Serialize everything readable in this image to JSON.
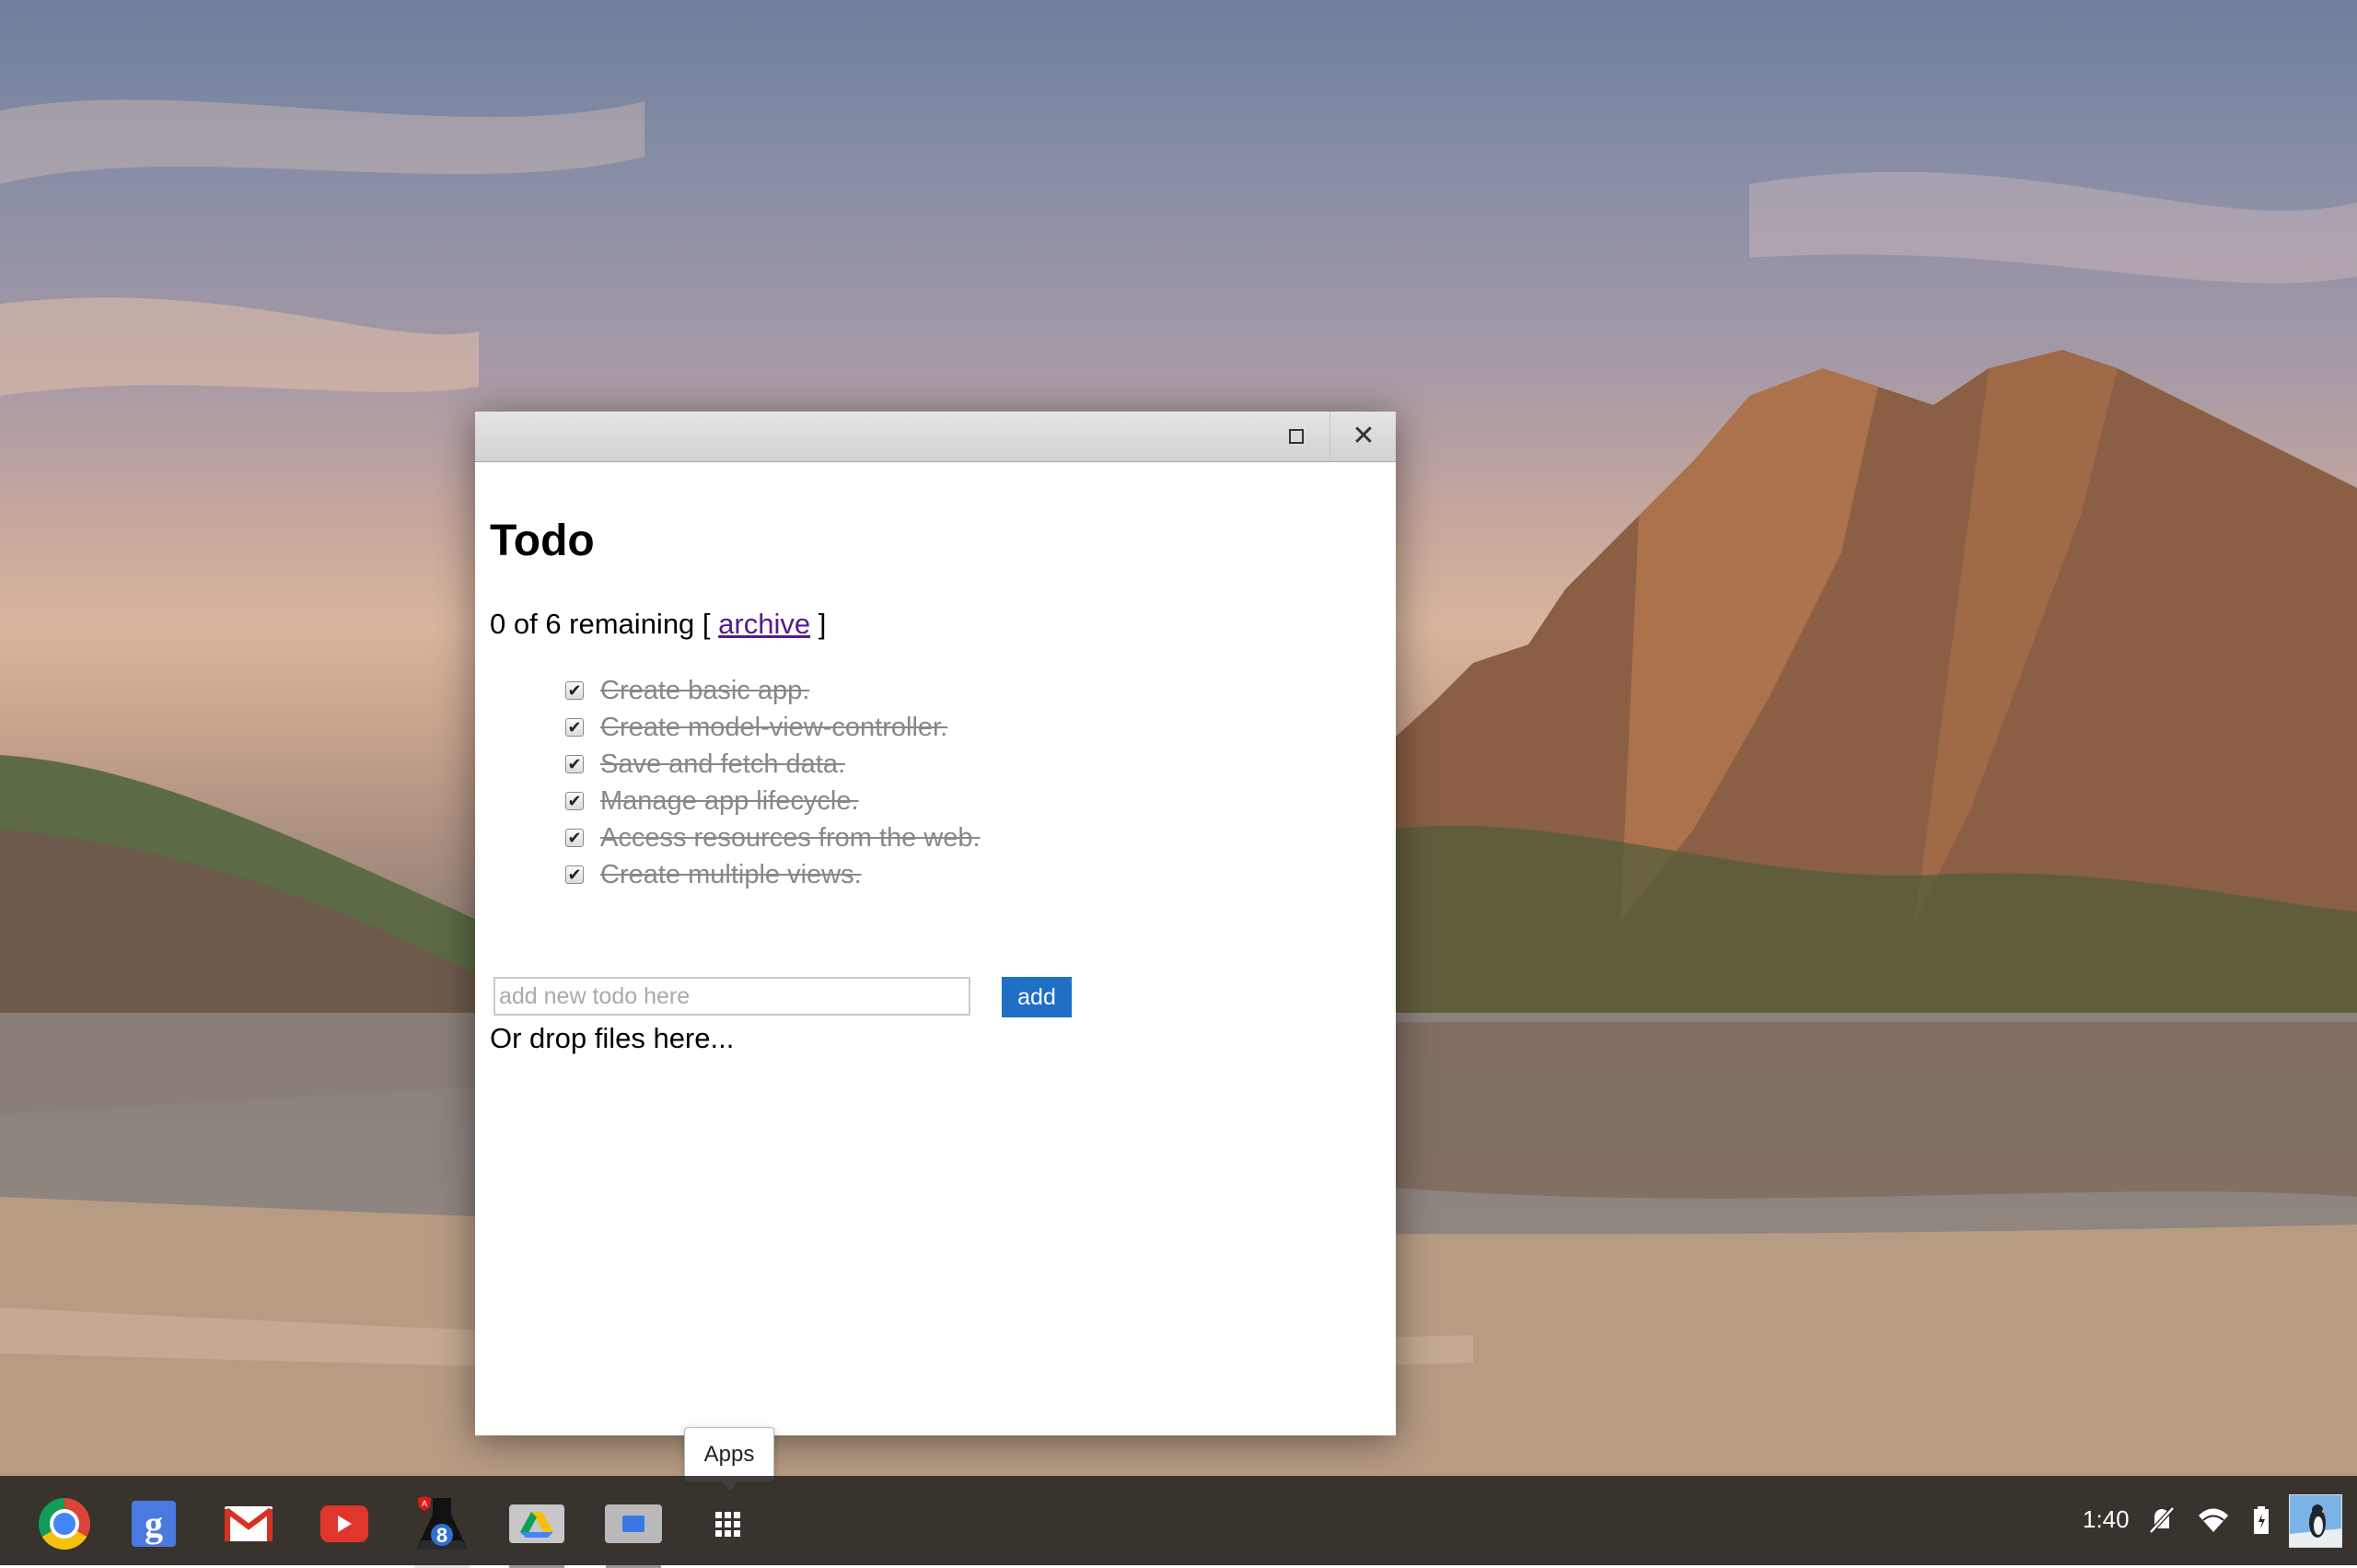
{
  "window": {
    "maximize_label": "maximize",
    "close_glyph": "✕"
  },
  "app": {
    "title": "Todo",
    "remaining_prefix": "0 of 6 remaining [",
    "archive_link": "archive",
    "remaining_suffix": "]",
    "todos": [
      {
        "text": "Create basic app.",
        "done": true
      },
      {
        "text": "Create model-view-controller.",
        "done": true
      },
      {
        "text": "Save and fetch data.",
        "done": true
      },
      {
        "text": "Manage app lifecycle.",
        "done": true
      },
      {
        "text": "Access resources from the web.",
        "done": true
      },
      {
        "text": "Create multiple views.",
        "done": true
      }
    ],
    "new_todo_placeholder": "add new todo here",
    "add_button": "add",
    "drop_text": "Or drop files here..."
  },
  "tooltip": {
    "text": "Apps"
  },
  "shelf": {
    "items": [
      {
        "name": "chrome",
        "icon": "chrome-icon"
      },
      {
        "name": "google-search",
        "icon": "google-icon",
        "glyph": "g"
      },
      {
        "name": "gmail",
        "icon": "gmail-icon"
      },
      {
        "name": "youtube",
        "icon": "youtube-icon"
      },
      {
        "name": "angular-batarang",
        "icon": "flask-icon",
        "badge": "8"
      },
      {
        "name": "google-drive",
        "icon": "drive-icon"
      },
      {
        "name": "files",
        "icon": "folder-icon"
      },
      {
        "name": "apps",
        "icon": "apps-grid-icon"
      }
    ],
    "clock": "1:40"
  },
  "colors": {
    "accent": "#1f6fc5",
    "link": "#551a8b",
    "done_text": "#888888",
    "shelf": "#282422"
  }
}
